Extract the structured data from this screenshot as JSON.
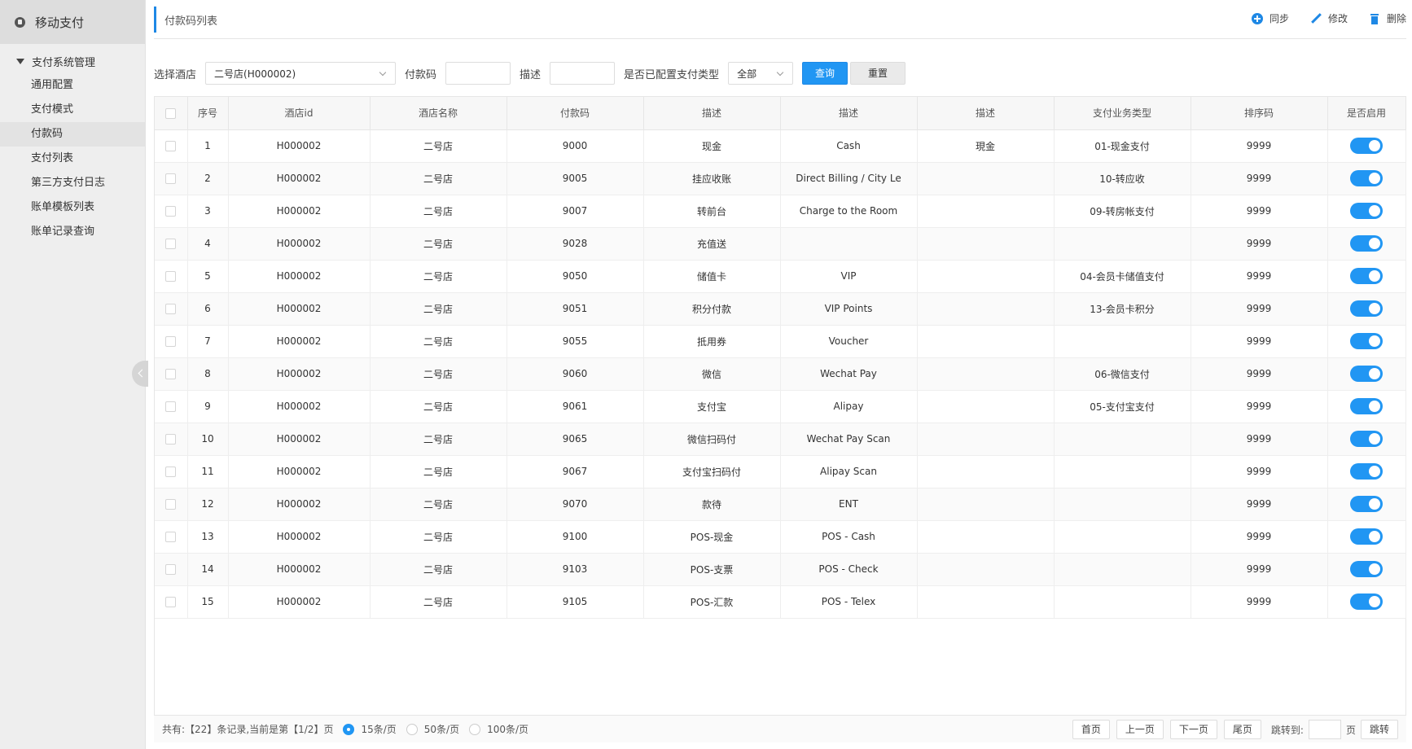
{
  "sidebar": {
    "app_title": "移动支付",
    "group_label": "支付系统管理",
    "items": [
      {
        "label": "通用配置"
      },
      {
        "label": "支付模式"
      },
      {
        "label": "付款码"
      },
      {
        "label": "支付列表"
      },
      {
        "label": "第三方支付日志"
      },
      {
        "label": "账单模板列表"
      },
      {
        "label": "账单记录查询"
      }
    ]
  },
  "header": {
    "title": "付款码列表",
    "actions": {
      "sync": "同步",
      "edit": "修改",
      "delete": "删除"
    }
  },
  "filters": {
    "hotel_label": "选择酒店",
    "hotel_value": "二号店(H000002)",
    "code_label": "付款码",
    "desc_label": "描述",
    "configured_label": "是否已配置支付类型",
    "configured_value": "全部",
    "query_button": "查询",
    "reset_button": "重置"
  },
  "table": {
    "headers": [
      "序号",
      "酒店id",
      "酒店名称",
      "付款码",
      "描述",
      "描述",
      "描述",
      "支付业务类型",
      "排序码",
      "是否启用"
    ],
    "rows": [
      {
        "no": "1",
        "hotel_id": "H000002",
        "hotel_name": "二号店",
        "code": "9000",
        "desc1": "现金",
        "desc2": "Cash",
        "desc3": "現金",
        "biz_type": "01-现金支付",
        "sort": "9999",
        "enabled": true
      },
      {
        "no": "2",
        "hotel_id": "H000002",
        "hotel_name": "二号店",
        "code": "9005",
        "desc1": "挂应收账",
        "desc2": "Direct Billing / City Le",
        "desc3": "",
        "biz_type": "10-转应收",
        "sort": "9999",
        "enabled": true
      },
      {
        "no": "3",
        "hotel_id": "H000002",
        "hotel_name": "二号店",
        "code": "9007",
        "desc1": "转前台",
        "desc2": "Charge to the Room",
        "desc3": "",
        "biz_type": "09-转房帐支付",
        "sort": "9999",
        "enabled": true
      },
      {
        "no": "4",
        "hotel_id": "H000002",
        "hotel_name": "二号店",
        "code": "9028",
        "desc1": "充值送",
        "desc2": "",
        "desc3": "",
        "biz_type": "",
        "sort": "9999",
        "enabled": true
      },
      {
        "no": "5",
        "hotel_id": "H000002",
        "hotel_name": "二号店",
        "code": "9050",
        "desc1": "储值卡",
        "desc2": "VIP",
        "desc3": "",
        "biz_type": "04-会员卡储值支付",
        "sort": "9999",
        "enabled": true
      },
      {
        "no": "6",
        "hotel_id": "H000002",
        "hotel_name": "二号店",
        "code": "9051",
        "desc1": "积分付款",
        "desc2": "VIP Points",
        "desc3": "",
        "biz_type": "13-会员卡积分",
        "sort": "9999",
        "enabled": true
      },
      {
        "no": "7",
        "hotel_id": "H000002",
        "hotel_name": "二号店",
        "code": "9055",
        "desc1": "抵用券",
        "desc2": "Voucher",
        "desc3": "",
        "biz_type": "",
        "sort": "9999",
        "enabled": true
      },
      {
        "no": "8",
        "hotel_id": "H000002",
        "hotel_name": "二号店",
        "code": "9060",
        "desc1": "微信",
        "desc2": "Wechat Pay",
        "desc3": "",
        "biz_type": "06-微信支付",
        "sort": "9999",
        "enabled": true
      },
      {
        "no": "9",
        "hotel_id": "H000002",
        "hotel_name": "二号店",
        "code": "9061",
        "desc1": "支付宝",
        "desc2": "Alipay",
        "desc3": "",
        "biz_type": "05-支付宝支付",
        "sort": "9999",
        "enabled": true
      },
      {
        "no": "10",
        "hotel_id": "H000002",
        "hotel_name": "二号店",
        "code": "9065",
        "desc1": "微信扫码付",
        "desc2": "Wechat Pay Scan",
        "desc3": "",
        "biz_type": "",
        "sort": "9999",
        "enabled": true
      },
      {
        "no": "11",
        "hotel_id": "H000002",
        "hotel_name": "二号店",
        "code": "9067",
        "desc1": "支付宝扫码付",
        "desc2": "Alipay Scan",
        "desc3": "",
        "biz_type": "",
        "sort": "9999",
        "enabled": true
      },
      {
        "no": "12",
        "hotel_id": "H000002",
        "hotel_name": "二号店",
        "code": "9070",
        "desc1": "款待",
        "desc2": "ENT",
        "desc3": "",
        "biz_type": "",
        "sort": "9999",
        "enabled": true
      },
      {
        "no": "13",
        "hotel_id": "H000002",
        "hotel_name": "二号店",
        "code": "9100",
        "desc1": "POS-现金",
        "desc2": "POS - Cash",
        "desc3": "",
        "biz_type": "",
        "sort": "9999",
        "enabled": true
      },
      {
        "no": "14",
        "hotel_id": "H000002",
        "hotel_name": "二号店",
        "code": "9103",
        "desc1": "POS-支票",
        "desc2": "POS - Check",
        "desc3": "",
        "biz_type": "",
        "sort": "9999",
        "enabled": true
      },
      {
        "no": "15",
        "hotel_id": "H000002",
        "hotel_name": "二号店",
        "code": "9105",
        "desc1": "POS-汇款",
        "desc2": "POS - Telex",
        "desc3": "",
        "biz_type": "",
        "sort": "9999",
        "enabled": true
      }
    ]
  },
  "pager": {
    "summary": "共有:【22】条记录,当前是第【1/2】页",
    "size_options": [
      "15条/页",
      "50条/页",
      "100条/页"
    ],
    "selected_size": "15条/页",
    "first": "首页",
    "prev": "上一页",
    "next": "下一页",
    "last": "尾页",
    "jump_label": "跳转到:",
    "page_unit": "页",
    "jump_button": "跳转"
  },
  "colors": {
    "accent": "#2196f3",
    "sidebar_bg": "#eeeeee"
  },
  "icons": {
    "sync": "plus-circle-icon",
    "edit": "pencil-icon",
    "delete": "trash-icon"
  }
}
